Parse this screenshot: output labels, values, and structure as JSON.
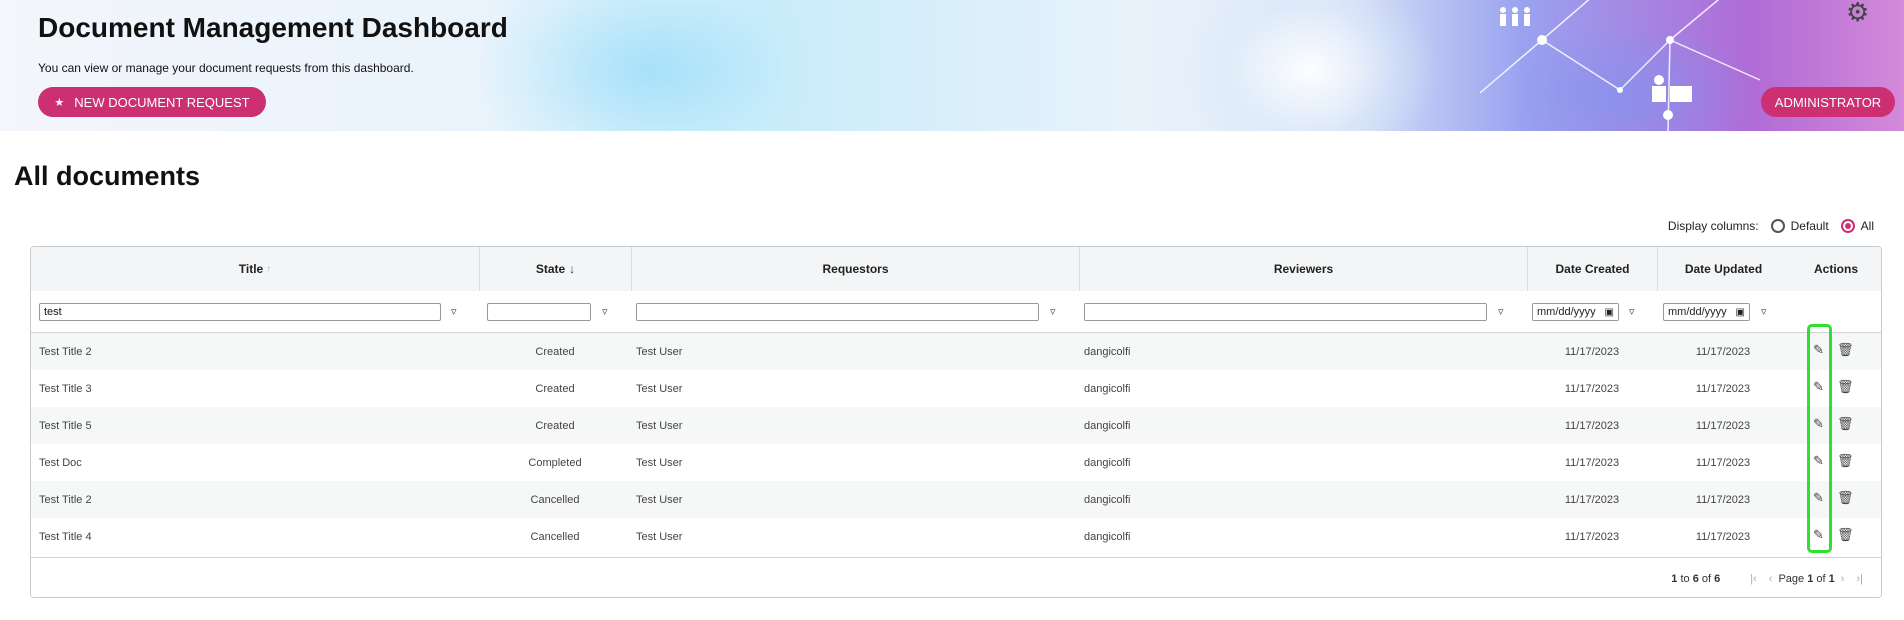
{
  "banner": {
    "title": "Document Management Dashboard",
    "subtitle": "You can view or manage your document requests from this dashboard.",
    "new_request_label": "NEW DOCUMENT REQUEST",
    "admin_label": "ADMINISTRATOR",
    "accent_color": "#cc2f72"
  },
  "page": {
    "heading": "All documents"
  },
  "display_columns": {
    "label": "Display columns:",
    "options": [
      "Default",
      "All"
    ],
    "selected": "All"
  },
  "table": {
    "columns": [
      "Title",
      "State",
      "Requestors",
      "Reviewers",
      "Date Created",
      "Date Updated",
      "Actions"
    ],
    "filters": {
      "title": "test",
      "state": "",
      "requestors": "",
      "reviewers": "",
      "date_created_placeholder": "mm/dd/yyyy",
      "date_updated_placeholder": "mm/dd/yyyy"
    },
    "rows": [
      {
        "title": "Test Title 2",
        "state": "Created",
        "requestors": "Test User",
        "reviewers": "dangicolfi",
        "created": "11/17/2023",
        "updated": "11/17/2023"
      },
      {
        "title": "Test Title 3",
        "state": "Created",
        "requestors": "Test User",
        "reviewers": "dangicolfi",
        "created": "11/17/2023",
        "updated": "11/17/2023"
      },
      {
        "title": "Test Title 5",
        "state": "Created",
        "requestors": "Test User",
        "reviewers": "dangicolfi",
        "created": "11/17/2023",
        "updated": "11/17/2023"
      },
      {
        "title": "Test Doc",
        "state": "Completed",
        "requestors": "Test User",
        "reviewers": "dangicolfi",
        "created": "11/17/2023",
        "updated": "11/17/2023"
      },
      {
        "title": "Test Title 2",
        "state": "Cancelled",
        "requestors": "Test User",
        "reviewers": "dangicolfi",
        "created": "11/17/2023",
        "updated": "11/17/2023"
      },
      {
        "title": "Test Title 4",
        "state": "Cancelled",
        "requestors": "Test User",
        "reviewers": "dangicolfi",
        "created": "11/17/2023",
        "updated": "11/17/2023"
      }
    ]
  },
  "pagination": {
    "from": "1",
    "to_word": "to",
    "to": "6",
    "of_word": "of",
    "total": "6",
    "page_word": "Page",
    "page": "1",
    "pages": "1"
  },
  "icons": {
    "gear": "gear-icon",
    "star": "star-icon",
    "filter": "filter-icon",
    "calendar": "calendar-icon",
    "edit": "pencil-icon",
    "delete": "trash-icon",
    "sort_desc": "arrow-down-icon",
    "sort_asc": "arrow-up-icon"
  }
}
